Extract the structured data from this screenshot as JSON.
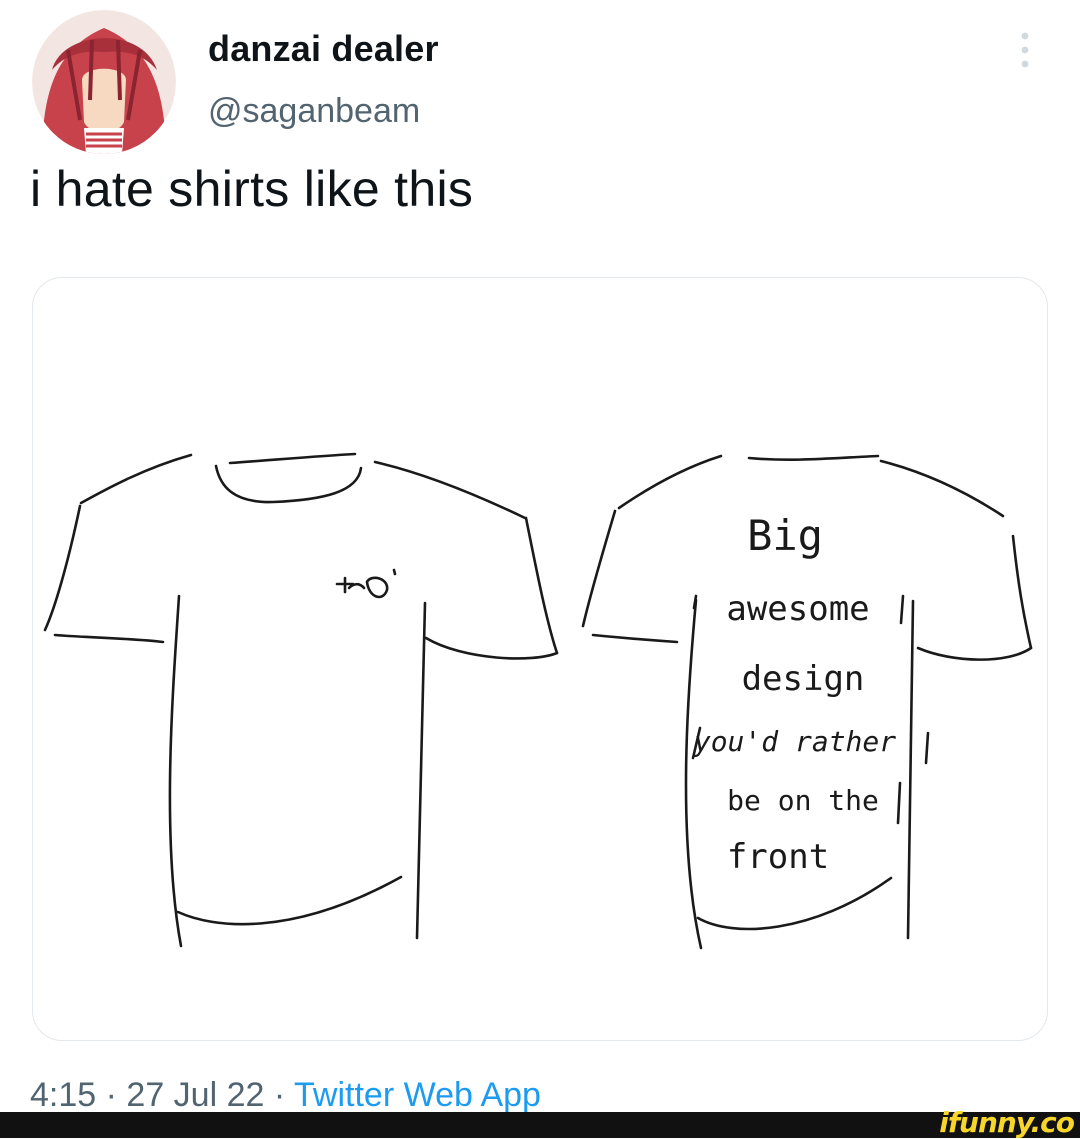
{
  "tweet": {
    "author": {
      "display_name": "danzai dealer",
      "handle": "@saganbeam",
      "avatar_icon": "avatar-illustration"
    },
    "more_icon": "more-vertical-icon",
    "text": "i hate shirts like this",
    "media": {
      "left_shirt_chest_doodle": "+o",
      "right_shirt_text_lines": [
        "Big",
        "awesome",
        "design",
        "you'd rather",
        "be on the",
        "front"
      ]
    },
    "meta": {
      "time": "4:15",
      "separator": " · ",
      "date": "27 Jul 22",
      "source": "Twitter Web App"
    }
  },
  "watermark": {
    "text": "ifunny.co"
  },
  "colors": {
    "text_primary": "#0f1419",
    "text_secondary": "#536471",
    "link": "#1d9bf0",
    "card_border": "#e3e8ec",
    "watermark": "#f7d62c"
  }
}
